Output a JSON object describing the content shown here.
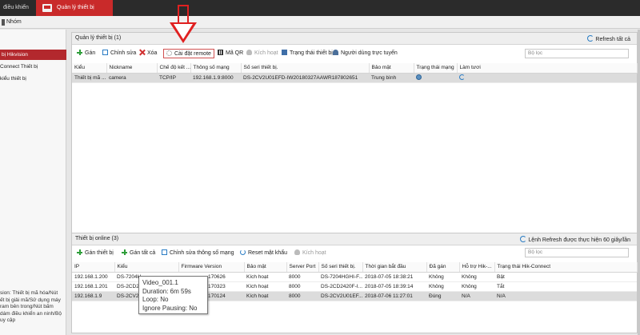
{
  "topbar": {
    "tab1": "điều khiển",
    "tab2": "Quản lý thiết bị"
  },
  "groupbar": {
    "label": "Nhóm"
  },
  "sidebar": {
    "items": [
      "bị Hikvision",
      "Connect Thiết bị",
      "kiểu thiết bị"
    ],
    "note": "sion: Thiết bị mã hóa/Nút\nết bị giải mã/Sử dụng máy\nram bên trong/Nút bấm\ndám điều khiển an ninh/Bộ\nuy cập"
  },
  "devices_panel": {
    "title": "Quản lý thiết bị (1)",
    "refresh_label": "Refresh tất cả",
    "toolbar": {
      "add": "Gán",
      "edit": "Chỉnh sửa",
      "delete": "Xóa",
      "remote": "Cài đặt remote",
      "qr": "Mã QR",
      "activate": "Kích hoạt",
      "device_status": "Trạng thái thiết bị",
      "online_user": "Người dùng trực tuyến"
    },
    "filter_placeholder": "Bộ lọc",
    "columns": [
      "Kiểu",
      "Nickname",
      "Chế độ kết ...",
      "Thông số mạng",
      "Số seri thiết bị.",
      "Bảo mật",
      "Trạng thái mạng",
      "Làm tươi"
    ],
    "rows": [
      {
        "type": "Thiết bị mã ...",
        "nickname": "camera",
        "mode": "TCP/IP",
        "network": "192.168.1.9:8000",
        "serial": "DS-2CV2U01EFD-IW20180327AAWR187802651",
        "security": "Trung bình"
      }
    ]
  },
  "online_panel": {
    "title": "Thiết bị online (3)",
    "refresh_label": "Lệnh Refresh được thực hiện 60 giây/lần",
    "toolbar": {
      "add_device": "Gán thiết bị",
      "add_all": "Gán tất cả",
      "edit_network": "Chỉnh sửa thông số mạng",
      "reset_password": "Reset mật khẩu",
      "activate": "Kích hoạt"
    },
    "filter_placeholder": "Bộ lọc",
    "columns": [
      "IP",
      "Kiểu",
      "Firmware Version",
      "Bảo mật",
      "Server Port",
      "Số seri thiết bị.",
      "Thời gian bắt đầu",
      "Đã gán",
      "Hỗ trợ Hik-...",
      "Trạng thái Hik-Connect"
    ],
    "rows": [
      {
        "ip": "192.168.1.200",
        "type": "DS-7204H",
        "fw": "170626",
        "sec": "Kích hoạt",
        "port": "8000",
        "serial": "DS-7204HGHI-F...",
        "start": "2018-07-05 18:38:21",
        "added": "Không",
        "hik": "Không",
        "hikc": "Bật"
      },
      {
        "ip": "192.168.1.201",
        "type": "DS-2CD24",
        "fw": "170323",
        "sec": "Kích hoạt",
        "port": "8000",
        "serial": "DS-2CD2420F-I...",
        "start": "2018-07-05 18:39:14",
        "added": "Không",
        "hik": "Không",
        "hikc": "Tắt"
      },
      {
        "ip": "192.168.1.9",
        "type": "DS-2CV2U",
        "fw": "170124",
        "sec": "Kích hoạt",
        "port": "8000",
        "serial": "DS-2CV2U01EF...",
        "start": "2018-07-06 11:27:01",
        "added": "Đúng",
        "hik": "N/A",
        "hikc": "N/A"
      }
    ]
  },
  "tooltip": {
    "line1": "Video_001.1",
    "line2": "Duration: 6m 59s",
    "line3": "Loop: No",
    "line4": "Ignore Pausing: No"
  }
}
